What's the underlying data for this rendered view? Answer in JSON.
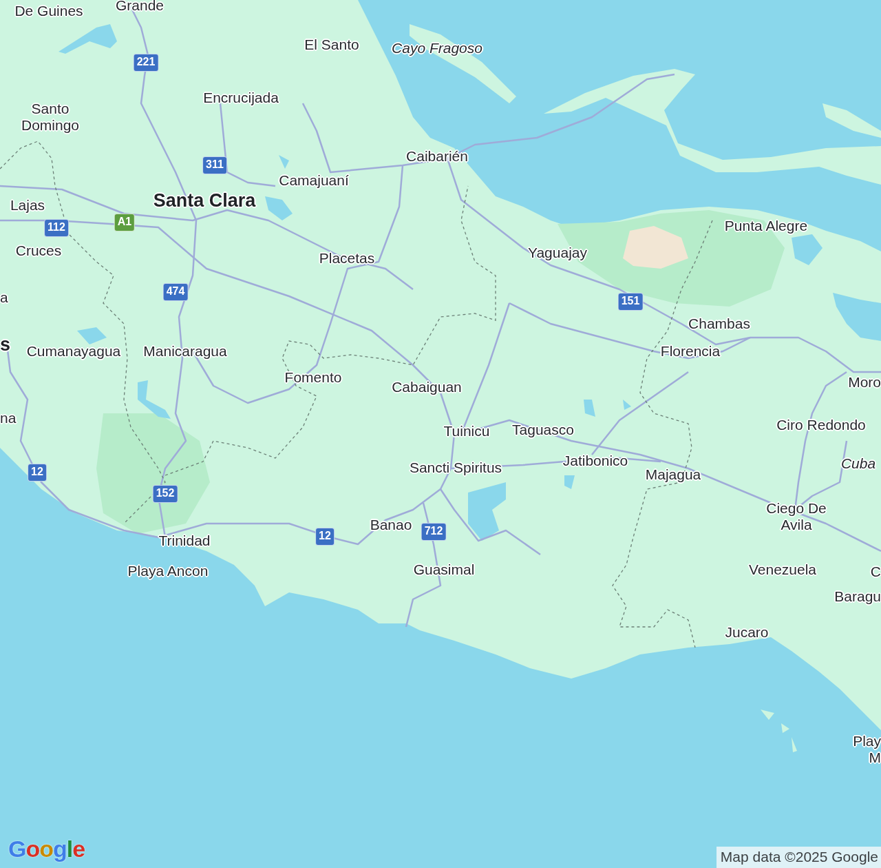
{
  "map": {
    "labels": [
      {
        "text": "De Guines",
        "kind": "town"
      },
      {
        "text": "Grande",
        "kind": "town"
      },
      {
        "text": "El Santo",
        "kind": "town"
      },
      {
        "text": "Cayo Fragoso",
        "kind": "island"
      },
      {
        "text": "Encrucijada",
        "kind": "town"
      },
      {
        "text": "Santo Domingo",
        "kind": "town"
      },
      {
        "text": "Caibarién",
        "kind": "town"
      },
      {
        "text": "Camajuaní",
        "kind": "town"
      },
      {
        "text": "Lajas",
        "kind": "town"
      },
      {
        "text": "Santa Clara",
        "kind": "city"
      },
      {
        "text": "Cruces",
        "kind": "town"
      },
      {
        "text": "Punta Alegre",
        "kind": "town"
      },
      {
        "text": "Placetas",
        "kind": "town"
      },
      {
        "text": "Yaguajay",
        "kind": "town"
      },
      {
        "text": "a",
        "kind": "town"
      },
      {
        "text": "Chambas",
        "kind": "town"
      },
      {
        "text": "s",
        "kind": "city"
      },
      {
        "text": "Cumanayagua",
        "kind": "town"
      },
      {
        "text": "Manicaragua",
        "kind": "town"
      },
      {
        "text": "Florencia",
        "kind": "town"
      },
      {
        "text": "Fomento",
        "kind": "town"
      },
      {
        "text": "Cabaiguan",
        "kind": "town"
      },
      {
        "text": "Moro",
        "kind": "town"
      },
      {
        "text": "na",
        "kind": "town"
      },
      {
        "text": "Tuinicu",
        "kind": "town"
      },
      {
        "text": "Taguasco",
        "kind": "town"
      },
      {
        "text": "Ciro Redondo",
        "kind": "town"
      },
      {
        "text": "Sancti Spiritus",
        "kind": "town"
      },
      {
        "text": "Jatibonico",
        "kind": "town"
      },
      {
        "text": "Majagua",
        "kind": "town"
      },
      {
        "text": "Cuba",
        "kind": "island"
      },
      {
        "text": "Banao",
        "kind": "town"
      },
      {
        "text": "Ciego De Avila",
        "kind": "town"
      },
      {
        "text": "Trinidad",
        "kind": "town"
      },
      {
        "text": "Playa Ancon",
        "kind": "town"
      },
      {
        "text": "Guasimal",
        "kind": "town"
      },
      {
        "text": "Venezuela",
        "kind": "town"
      },
      {
        "text": "C",
        "kind": "town"
      },
      {
        "text": "Baragu",
        "kind": "town"
      },
      {
        "text": "Jucaro",
        "kind": "town"
      },
      {
        "text": "Play M",
        "kind": "town"
      }
    ],
    "road_shields": [
      {
        "number": "221",
        "color": "#3b6fc4"
      },
      {
        "number": "311",
        "color": "#3b6fc4"
      },
      {
        "number": "112",
        "color": "#3b6fc4"
      },
      {
        "number": "A1",
        "color": "#5c9e3f"
      },
      {
        "number": "474",
        "color": "#3b6fc4"
      },
      {
        "number": "151",
        "color": "#3b6fc4"
      },
      {
        "number": "12",
        "color": "#3b6fc4"
      },
      {
        "number": "152",
        "color": "#3b6fc4"
      },
      {
        "number": "12",
        "color": "#3b6fc4"
      },
      {
        "number": "712",
        "color": "#3b6fc4"
      }
    ]
  },
  "logo": {
    "text": "Google"
  },
  "attribution": "Map data ©2025 Google"
}
